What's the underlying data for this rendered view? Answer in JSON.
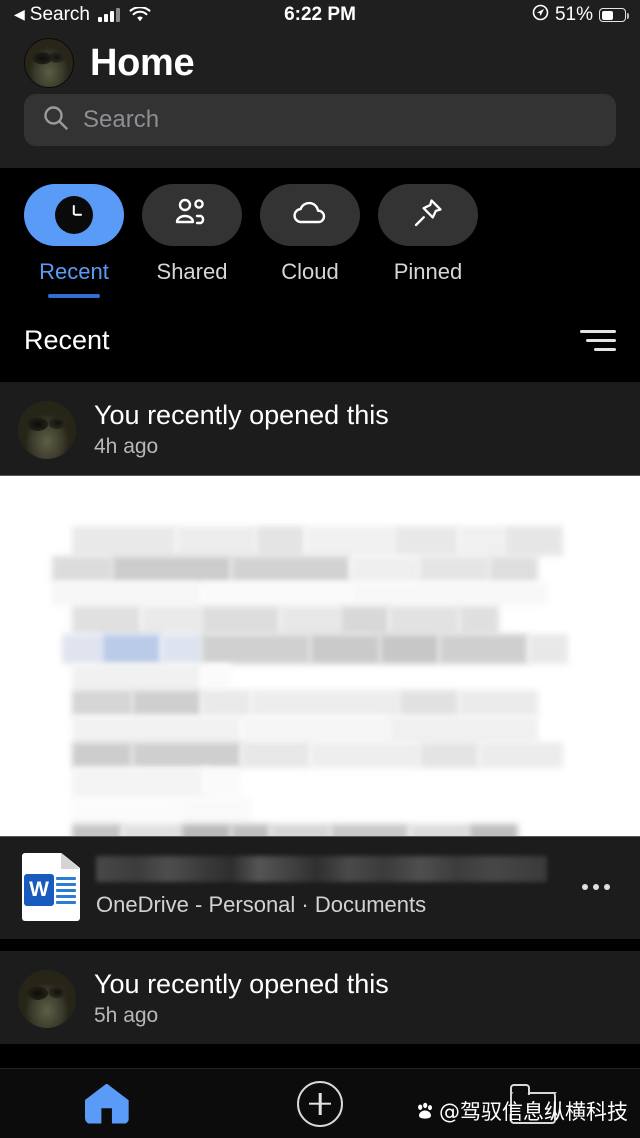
{
  "status_bar": {
    "back_label": "Search",
    "back_arrow": "◀",
    "time": "6:22 PM",
    "battery_percent": "51%",
    "icons": [
      "signal-bars-icon",
      "wifi-icon",
      "location-arrow-icon",
      "battery-icon"
    ]
  },
  "header": {
    "title": "Home",
    "avatar": "user-avatar",
    "search": {
      "placeholder": "Search",
      "value": "",
      "icon": "search-icon"
    }
  },
  "tabs": [
    {
      "label": "Recent",
      "icon": "clock-icon",
      "active": true
    },
    {
      "label": "Shared",
      "icon": "people-icon",
      "active": false
    },
    {
      "label": "Cloud",
      "icon": "cloud-icon",
      "active": false
    },
    {
      "label": "Pinned",
      "icon": "pin-icon",
      "active": false
    }
  ],
  "section": {
    "title": "Recent",
    "sort_icon": "sort-filter-icon"
  },
  "cards": [
    {
      "activity": "You recently opened this",
      "time": "4h ago",
      "preview": "document-preview-redacted",
      "file": {
        "name": "",
        "name_state": "redacted",
        "icon": "word-document-icon",
        "icon_letter": "W",
        "location": "OneDrive - Personal · Documents",
        "more_icon": "more-options-icon"
      }
    },
    {
      "activity": "You recently opened this",
      "time": "5h ago"
    }
  ],
  "bottom_nav": [
    {
      "name": "home",
      "icon": "home-icon",
      "active": true
    },
    {
      "name": "create",
      "icon": "plus-circle-icon",
      "active": false
    },
    {
      "name": "files",
      "icon": "folder-icon",
      "active": false
    }
  ],
  "watermark": {
    "text": "@驾驭信息纵横科技",
    "icon": "paw-logo-icon"
  },
  "colors": {
    "accent_blue": "#5b9bf8",
    "underline_blue": "#2f6fd0",
    "background": "#000000",
    "surface": "#1c1c1c",
    "header_surface": "#1f1f1f",
    "pill_inactive": "#333333",
    "word_blue": "#185abd"
  }
}
